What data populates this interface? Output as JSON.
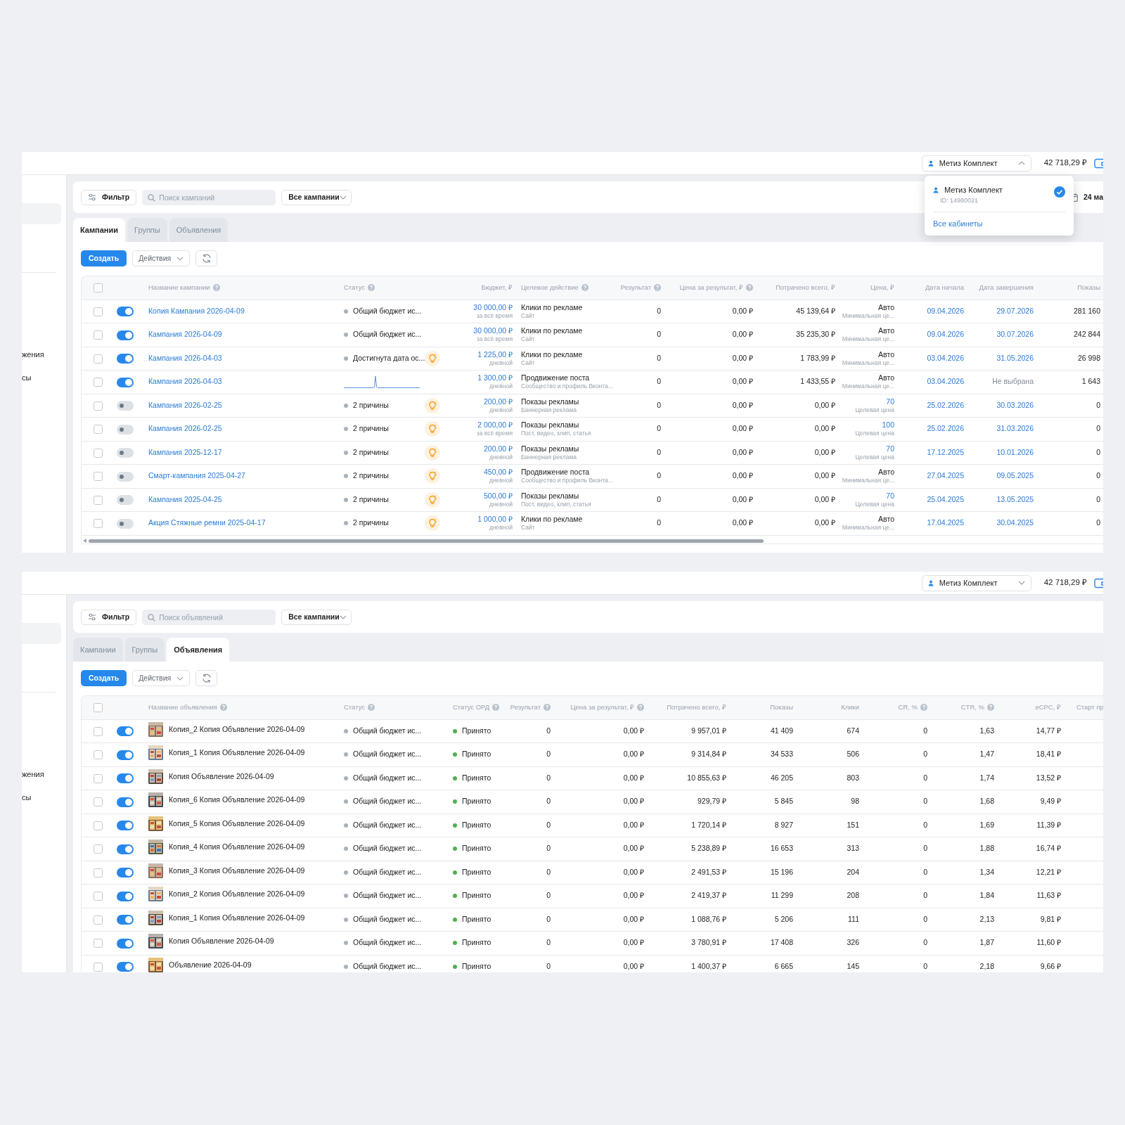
{
  "screens": [
    {
      "header": {
        "account": "Метиз Комплект",
        "account_open": true,
        "balance": "42 718,29 ₽"
      },
      "dropdown": {
        "name": "Метиз Комплект",
        "id": "ID: 14980021",
        "selected": true,
        "link": "Все кабинеты"
      },
      "sidebar": [
        "жения",
        "сы"
      ],
      "toolbar": {
        "filter": "Фильтр",
        "search_placeholder": "Поиск кампаний",
        "select": "Все кампании",
        "date": "24 ма"
      },
      "tabs": [
        {
          "label": "Кампании",
          "selected": true
        },
        {
          "label": "Группы",
          "selected": false
        },
        {
          "label": "Объявления",
          "selected": false
        }
      ],
      "actions": {
        "create": "Создать",
        "menu": "Действия"
      },
      "horizontal_scrollbar": true,
      "table": {
        "kind": "campaigns",
        "all_checked": false,
        "columns": [
          {
            "label": "Название кампании",
            "help": true
          },
          {
            "label": "Статус",
            "help": true
          },
          {
            "label": "Бюджет, ₽",
            "help": false
          },
          {
            "label": "Целевое действие",
            "help": true
          },
          {
            "label": "Результат",
            "help": true
          },
          {
            "label": "Цена за результат, ₽",
            "help": true
          },
          {
            "label": "Потрачено всего, ₽",
            "help": false
          },
          {
            "label": "Цена, ₽",
            "help": false
          },
          {
            "label": "Дата начала",
            "help": false
          },
          {
            "label": "Дата завершения",
            "help": false
          },
          {
            "label": "Показы",
            "help": false
          }
        ],
        "rows": [
          {
            "checked": false,
            "on": true,
            "cells": [
              {
                "kind": "link",
                "text": "Копия Кампания 2026-04-09"
              },
              {
                "kind": "status",
                "text": "Общий бюджет ис...",
                "hint": false
              },
              {
                "kind": "pair",
                "text": "30 000,00 ₽",
                "note": "за всё время",
                "accent": true
              },
              {
                "kind": "pair",
                "text": "Клики по рекламе",
                "note": "Сайт",
                "accent": false
              },
              "0",
              "0,00 ₽",
              "45 139,64 ₽",
              {
                "kind": "pair",
                "text": "Авто",
                "note": "Минимальная це...",
                "accent": false
              },
              {
                "kind": "date",
                "text": "09.04.2026",
                "set": true
              },
              {
                "kind": "date",
                "text": "29.07.2026",
                "set": true
              },
              "281 160"
            ]
          },
          {
            "checked": false,
            "on": true,
            "cells": [
              {
                "kind": "link",
                "text": "Кампания 2026-04-09"
              },
              {
                "kind": "status",
                "text": "Общий бюджет ис...",
                "hint": false
              },
              {
                "kind": "pair",
                "text": "30 000,00 ₽",
                "note": "за всё время",
                "accent": true
              },
              {
                "kind": "pair",
                "text": "Клики по рекламе",
                "note": "Сайт",
                "accent": false
              },
              "0",
              "0,00 ₽",
              "35 235,30 ₽",
              {
                "kind": "pair",
                "text": "Авто",
                "note": "Минимальная це...",
                "accent": false
              },
              {
                "kind": "date",
                "text": "09.04.2026",
                "set": true
              },
              {
                "kind": "date",
                "text": "30.07.2026",
                "set": true
              },
              "242 844"
            ]
          },
          {
            "checked": false,
            "on": true,
            "cells": [
              {
                "kind": "link",
                "text": "Кампания 2026-04-03"
              },
              {
                "kind": "status",
                "text": "Достигнута дата ос...",
                "hint": true
              },
              {
                "kind": "pair",
                "text": "1 225,00 ₽",
                "note": "дневной",
                "accent": true
              },
              {
                "kind": "pair",
                "text": "Клики по рекламе",
                "note": "Сайт",
                "accent": false
              },
              "0",
              "0,00 ₽",
              "1 783,99 ₽",
              {
                "kind": "pair",
                "text": "Авто",
                "note": "Минимальная це...",
                "accent": false
              },
              {
                "kind": "date",
                "text": "03.04.2026",
                "set": true
              },
              {
                "kind": "date",
                "text": "31.05.2026",
                "set": true
              },
              "26 998"
            ]
          },
          {
            "checked": false,
            "on": true,
            "cells": [
              {
                "kind": "link",
                "text": "Кампания 2026-04-03"
              },
              {
                "kind": "sparkline"
              },
              {
                "kind": "pair",
                "text": "1 300,00 ₽",
                "note": "дневной",
                "accent": true
              },
              {
                "kind": "pair",
                "text": "Продвижение поста",
                "note": "Сообщество и профиль Вконта...",
                "accent": false
              },
              "0",
              "0,00 ₽",
              "1 433,55 ₽",
              {
                "kind": "pair",
                "text": "Авто",
                "note": "Минимальная це...",
                "accent": false
              },
              {
                "kind": "date",
                "text": "03.04.2026",
                "set": true
              },
              {
                "kind": "date",
                "text": "Не выбрана",
                "set": false
              },
              "1 643"
            ]
          },
          {
            "checked": false,
            "on": false,
            "cells": [
              {
                "kind": "link",
                "text": "Кампания 2026-02-25"
              },
              {
                "kind": "status",
                "text": "2 причины",
                "hint": true
              },
              {
                "kind": "pair",
                "text": "200,00 ₽",
                "note": "дневной",
                "accent": true
              },
              {
                "kind": "pair",
                "text": "Показы рекламы",
                "note": "Баннерная реклама",
                "accent": false
              },
              "0",
              "0,00 ₽",
              "0,00 ₽",
              {
                "kind": "pair",
                "text": "70",
                "note": "Целевая цена",
                "accent": true
              },
              {
                "kind": "date",
                "text": "25.02.2026",
                "set": true
              },
              {
                "kind": "date",
                "text": "30.03.2026",
                "set": true
              },
              "0"
            ]
          },
          {
            "checked": false,
            "on": false,
            "cells": [
              {
                "kind": "link",
                "text": "Кампания 2026-02-25"
              },
              {
                "kind": "status",
                "text": "2 причины",
                "hint": true
              },
              {
                "kind": "pair",
                "text": "2 000,00 ₽",
                "note": "за всё время",
                "accent": true
              },
              {
                "kind": "pair",
                "text": "Показы рекламы",
                "note": "Пост, видео, клип, статья",
                "accent": false
              },
              "0",
              "0,00 ₽",
              "0,00 ₽",
              {
                "kind": "pair",
                "text": "100",
                "note": "Целевая цена",
                "accent": true
              },
              {
                "kind": "date",
                "text": "25.02.2026",
                "set": true
              },
              {
                "kind": "date",
                "text": "31.03.2026",
                "set": true
              },
              "0"
            ]
          },
          {
            "checked": false,
            "on": false,
            "cells": [
              {
                "kind": "link",
                "text": "Кампания 2025-12-17"
              },
              {
                "kind": "status",
                "text": "2 причины",
                "hint": true
              },
              {
                "kind": "pair",
                "text": "200,00 ₽",
                "note": "дневной",
                "accent": true
              },
              {
                "kind": "pair",
                "text": "Показы рекламы",
                "note": "Баннерная реклама",
                "accent": false
              },
              "0",
              "0,00 ₽",
              "0,00 ₽",
              {
                "kind": "pair",
                "text": "70",
                "note": "Целевая цена",
                "accent": true
              },
              {
                "kind": "date",
                "text": "17.12.2025",
                "set": true
              },
              {
                "kind": "date",
                "text": "10.01.2026",
                "set": true
              },
              "0"
            ]
          },
          {
            "checked": false,
            "on": false,
            "cells": [
              {
                "kind": "link",
                "text": "Смарт-кампания 2025-04-27"
              },
              {
                "kind": "status",
                "text": "2 причины",
                "hint": true
              },
              {
                "kind": "pair",
                "text": "450,00 ₽",
                "note": "дневной",
                "accent": true
              },
              {
                "kind": "pair",
                "text": "Продвижение поста",
                "note": "Сообщество и профиль Вконта...",
                "accent": false
              },
              "0",
              "0,00 ₽",
              "0,00 ₽",
              {
                "kind": "pair",
                "text": "Авто",
                "note": "Минимальная це...",
                "accent": false
              },
              {
                "kind": "date",
                "text": "27.04.2025",
                "set": true
              },
              {
                "kind": "date",
                "text": "09.05.2025",
                "set": true
              },
              "0"
            ]
          },
          {
            "checked": false,
            "on": false,
            "cells": [
              {
                "kind": "link",
                "text": "Кампания 2025-04-25"
              },
              {
                "kind": "status",
                "text": "2 причины",
                "hint": true
              },
              {
                "kind": "pair",
                "text": "500,00 ₽",
                "note": "дневной",
                "accent": true
              },
              {
                "kind": "pair",
                "text": "Показы рекламы",
                "note": "Пост, видео, клип, статья",
                "accent": false
              },
              "0",
              "0,00 ₽",
              "0,00 ₽",
              {
                "kind": "pair",
                "text": "70",
                "note": "Целевая цена",
                "accent": true
              },
              {
                "kind": "date",
                "text": "25.04.2025",
                "set": true
              },
              {
                "kind": "date",
                "text": "13.05.2025",
                "set": true
              },
              "0"
            ]
          },
          {
            "checked": false,
            "on": false,
            "cells": [
              {
                "kind": "link",
                "text": "Акция Стяжные ремни 2025-04-17"
              },
              {
                "kind": "status",
                "text": "2 причины",
                "hint": true
              },
              {
                "kind": "pair",
                "text": "1 000,00 ₽",
                "note": "дневной",
                "accent": true
              },
              {
                "kind": "pair",
                "text": "Клики по рекламе",
                "note": "Сайт",
                "accent": false
              },
              "0",
              "0,00 ₽",
              "0,00 ₽",
              {
                "kind": "pair",
                "text": "Авто",
                "note": "Минимальная це...",
                "accent": false
              },
              {
                "kind": "date",
                "text": "17.04.2025",
                "set": true
              },
              {
                "kind": "date",
                "text": "30.04.2025",
                "set": true
              },
              "0"
            ]
          }
        ]
      }
    },
    {
      "header": {
        "account": "Метиз Комплект",
        "account_open": false,
        "balance": "42 718,29 ₽"
      },
      "sidebar": [
        "жения",
        "сы"
      ],
      "toolbar": {
        "filter": "Фильтр",
        "search_placeholder": "Поиск объявлений",
        "select": "Все кампании"
      },
      "tabs": [
        {
          "label": "Кампании",
          "selected": false
        },
        {
          "label": "Группы",
          "selected": false
        },
        {
          "label": "Объявления",
          "selected": true
        }
      ],
      "actions": {
        "create": "Создать",
        "menu": "Действия"
      },
      "table": {
        "kind": "ads",
        "all_checked": false,
        "columns": [
          {
            "label": "Название объявления",
            "help": true
          },
          {
            "label": "Статус",
            "help": true
          },
          {
            "label": "Статус ОРД",
            "help": true
          },
          {
            "label": "Результат",
            "help": true
          },
          {
            "label": "Цена за результат, ₽",
            "help": true
          },
          {
            "label": "Потрачено всего, ₽",
            "help": false
          },
          {
            "label": "Показы",
            "help": false
          },
          {
            "label": "Клики",
            "help": false
          },
          {
            "label": "CR, %",
            "help": true
          },
          {
            "label": "CTR, %",
            "help": true
          },
          {
            "label": "eCPC, ₽",
            "help": false
          },
          {
            "label": "Старт пр",
            "help": false
          }
        ],
        "rows": [
          {
            "checked": false,
            "on": true,
            "cells": [
              {
                "kind": "ad",
                "text": "Копия_2 Копия Объявление 2026-04-09"
              },
              {
                "kind": "status",
                "text": "Общий бюджет ис...",
                "hint": false
              },
              {
                "kind": "ord",
                "text": "Принято"
              },
              "0",
              "0,00 ₽",
              "9 957,01 ₽",
              "41 409",
              "674",
              "0",
              "1,63",
              "14,77 ₽"
            ]
          },
          {
            "checked": false,
            "on": true,
            "cells": [
              {
                "kind": "ad",
                "text": "Копия_1 Копия Объявление 2026-04-09"
              },
              {
                "kind": "status",
                "text": "Общий бюджет ис...",
                "hint": false
              },
              {
                "kind": "ord",
                "text": "Принято"
              },
              "0",
              "0,00 ₽",
              "9 314,84 ₽",
              "34 533",
              "506",
              "0",
              "1,47",
              "18,41 ₽"
            ]
          },
          {
            "checked": false,
            "on": true,
            "cells": [
              {
                "kind": "ad",
                "text": "Копия Объявление 2026-04-09"
              },
              {
                "kind": "status",
                "text": "Общий бюджет ис...",
                "hint": false
              },
              {
                "kind": "ord",
                "text": "Принято"
              },
              "0",
              "0,00 ₽",
              "10 855,63 ₽",
              "46 205",
              "803",
              "0",
              "1,74",
              "13,52 ₽"
            ]
          },
          {
            "checked": false,
            "on": true,
            "cells": [
              {
                "kind": "ad",
                "text": "Копия_6 Копия Объявление 2026-04-09"
              },
              {
                "kind": "status",
                "text": "Общий бюджет ис...",
                "hint": false
              },
              {
                "kind": "ord",
                "text": "Принято"
              },
              "0",
              "0,00 ₽",
              "929,79 ₽",
              "5 845",
              "98",
              "0",
              "1,68",
              "9,49 ₽"
            ]
          },
          {
            "checked": false,
            "on": true,
            "cells": [
              {
                "kind": "ad",
                "text": "Копия_5 Копия Объявление 2026-04-09"
              },
              {
                "kind": "status",
                "text": "Общий бюджет ис...",
                "hint": false
              },
              {
                "kind": "ord",
                "text": "Принято"
              },
              "0",
              "0,00 ₽",
              "1 720,14 ₽",
              "8 927",
              "151",
              "0",
              "1,69",
              "11,39 ₽"
            ]
          },
          {
            "checked": false,
            "on": true,
            "cells": [
              {
                "kind": "ad",
                "text": "Копия_4 Копия Объявление 2026-04-09"
              },
              {
                "kind": "status",
                "text": "Общий бюджет ис...",
                "hint": false
              },
              {
                "kind": "ord",
                "text": "Принято"
              },
              "0",
              "0,00 ₽",
              "5 238,89 ₽",
              "16 653",
              "313",
              "0",
              "1,88",
              "16,74 ₽"
            ]
          },
          {
            "checked": false,
            "on": true,
            "cells": [
              {
                "kind": "ad",
                "text": "Копия_3 Копия Объявление 2026-04-09"
              },
              {
                "kind": "status",
                "text": "Общий бюджет ис...",
                "hint": false
              },
              {
                "kind": "ord",
                "text": "Принято"
              },
              "0",
              "0,00 ₽",
              "2 491,53 ₽",
              "15 196",
              "204",
              "0",
              "1,34",
              "12,21 ₽"
            ]
          },
          {
            "checked": false,
            "on": true,
            "cells": [
              {
                "kind": "ad",
                "text": "Копия_2 Копия Объявление 2026-04-09"
              },
              {
                "kind": "status",
                "text": "Общий бюджет ис...",
                "hint": false
              },
              {
                "kind": "ord",
                "text": "Принято"
              },
              "0",
              "0,00 ₽",
              "2 419,37 ₽",
              "11 299",
              "208",
              "0",
              "1,84",
              "11,63 ₽"
            ]
          },
          {
            "checked": false,
            "on": true,
            "cells": [
              {
                "kind": "ad",
                "text": "Копия_1 Копия Объявление 2026-04-09"
              },
              {
                "kind": "status",
                "text": "Общий бюджет ис...",
                "hint": false
              },
              {
                "kind": "ord",
                "text": "Принято"
              },
              "0",
              "0,00 ₽",
              "1 088,76 ₽",
              "5 206",
              "111",
              "0",
              "2,13",
              "9,81 ₽"
            ]
          },
          {
            "checked": false,
            "on": true,
            "cells": [
              {
                "kind": "ad",
                "text": "Копия Объявление 2026-04-09"
              },
              {
                "kind": "status",
                "text": "Общий бюджет ис...",
                "hint": false
              },
              {
                "kind": "ord",
                "text": "Принято"
              },
              "0",
              "0,00 ₽",
              "3 780,91 ₽",
              "17 408",
              "326",
              "0",
              "1,87",
              "11,60 ₽"
            ]
          },
          {
            "checked": false,
            "on": true,
            "cells": [
              {
                "kind": "ad",
                "text": "Объявление 2026-04-09"
              },
              {
                "kind": "status",
                "text": "Общий бюджет ис...",
                "hint": false
              },
              {
                "kind": "ord",
                "text": "Принято"
              },
              "0",
              "0,00 ₽",
              "1 400,37 ₽",
              "6 665",
              "145",
              "0",
              "2,18",
              "9,66 ₽"
            ]
          }
        ]
      }
    }
  ]
}
